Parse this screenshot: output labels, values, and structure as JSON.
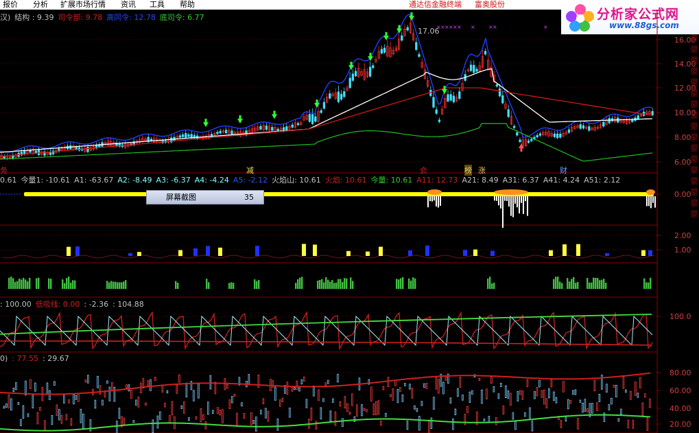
{
  "menu": {
    "items": [
      "报价",
      "分析",
      "扩展市场行情",
      "资讯",
      "工具",
      "帮助"
    ],
    "links": [
      "通达信金融终端",
      "富奥股份"
    ]
  },
  "logo": {
    "title": "分析家公式网",
    "url": "www.88gs.com"
  },
  "colors": {
    "bg": "#000000",
    "grid": "#7a0000",
    "axis": "#8b0000",
    "yellow": "#ffff00",
    "blue": "#2040ff",
    "green": "#33cc33",
    "red": "#d01818",
    "white": "#ffffff",
    "cyan": "#80ffff"
  },
  "main_panel": {
    "header": [
      {
        "text": "汉)",
        "color": "#c0c0c0"
      },
      {
        "text": "结构 : 9.39",
        "color": "#c0c0c0"
      },
      {
        "text": "司令部: 9.78",
        "color": "#d02020"
      },
      {
        "text": "高同令: 12.78",
        "color": "#2848ff"
      },
      {
        "text": "底司令: 6.77",
        "color": "#33cc33"
      }
    ],
    "peak_label": "17.06",
    "y_ticks": [
      "16.00",
      "14.00",
      "12.00",
      "10.00",
      "8.00",
      "6.00"
    ],
    "bottom_labels": [
      {
        "text": "务",
        "color": "#d02020"
      },
      {
        "text": "减",
        "color": "#e8e050"
      },
      {
        "text": "会",
        "color": "#d02020"
      },
      {
        "text": "榜",
        "color": "#e8c060"
      },
      {
        "text": "涨",
        "color": "#e8c060"
      },
      {
        "text": "财",
        "color": "#60a0ff"
      }
    ]
  },
  "panel2": {
    "header": [
      {
        "text": "0.61",
        "color": "#c0c0c0"
      },
      {
        "text": "今量1: -10.61",
        "color": "#c0c0c0"
      },
      {
        "text": "A1: -63.67",
        "color": "#c0c0c0"
      },
      {
        "text": "A2: -8.49",
        "color": "#80ffff"
      },
      {
        "text": "A3: -6.37",
        "color": "#80ffff"
      },
      {
        "text": "A4: -4.24",
        "color": "#80ffff"
      },
      {
        "text": "A5: -2.12",
        "color": "#3050ff"
      },
      {
        "text": "火焰山: 10.61",
        "color": "#c0c0c0"
      },
      {
        "text": "火焰: 10.61",
        "color": "#d02020"
      },
      {
        "text": "今量: 10.61",
        "color": "#33cc33"
      },
      {
        "text": "A11: 12.73",
        "color": "#d02020"
      },
      {
        "text": "A21: 8.49",
        "color": "#c0c0c0"
      },
      {
        "text": "A31: 6.37",
        "color": "#c0c0c0"
      },
      {
        "text": "A41: 4.24",
        "color": "#c0c0c0"
      },
      {
        "text": "A51: 2.12",
        "color": "#c0c0c0"
      }
    ],
    "y_ticks": [
      "0.00"
    ],
    "tooltip": {
      "label": "屏幕截图",
      "value": "35"
    }
  },
  "panel3": {
    "y_ticks": [
      "2.00",
      "1.00"
    ]
  },
  "panel5": {
    "header": [
      {
        "text": ": 100.00",
        "color": "#c0c0c0"
      },
      {
        "text": "低吸线: 0.00",
        "color": "#d02020"
      },
      {
        "text": ": -2.36",
        "color": "#c0c0c0"
      },
      {
        "text": ": 104.88",
        "color": "#c0c0c0"
      }
    ],
    "y_ticks": [
      "100.0"
    ]
  },
  "panel6": {
    "header": [
      {
        "text": "0)",
        "color": "#c0c0c0"
      },
      {
        "text": ": 77.55",
        "color": "#d02020"
      },
      {
        "text": ": 29.67",
        "color": "#c0c0c0"
      }
    ],
    "y_ticks": [
      "80.00",
      "60.00",
      "40.00",
      "20.00"
    ]
  },
  "right_strip_chars": "豪豪豪豪豪豪豪豪豪豪豪豪豪豪豪豪豪"
}
